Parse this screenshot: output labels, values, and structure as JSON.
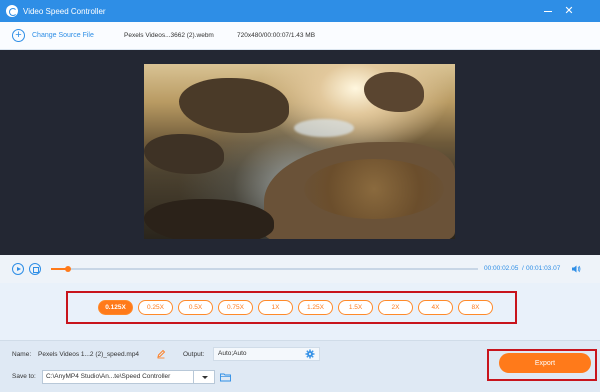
{
  "window": {
    "title": "Video Speed Controller",
    "close_glyph": "✕"
  },
  "toolbar": {
    "change_source_label": "Change Source File",
    "plus_glyph": "+",
    "file_name": "Pexels Videos...3662 (2).webm",
    "file_info": "720x480/00:00:07/1.43 MB"
  },
  "player": {
    "progress_fraction": 0.04,
    "current_time": "00:00:02.05",
    "separator": "/",
    "total_time": "00:01:03.07"
  },
  "speeds": {
    "options": [
      "0.125X",
      "0.25X",
      "0.5X",
      "0.75X",
      "1X",
      "1.25X",
      "1.5X",
      "2X",
      "4X",
      "8X"
    ],
    "selected": "0.125X"
  },
  "settings": {
    "name_label": "Name:",
    "name_value": "Pexels Videos 1...2 (2)_speed.mp4",
    "output_label": "Output:",
    "output_value": "Auto;Auto",
    "save_to_label": "Save to:",
    "save_to_value": "C:\\AnyMP4 Studio\\An...te\\Speed Controller"
  },
  "export": {
    "label": "Export"
  },
  "colors": {
    "accent": "#2e8ee6",
    "orange": "#ff7a1a",
    "highlight": "#c8141c"
  }
}
